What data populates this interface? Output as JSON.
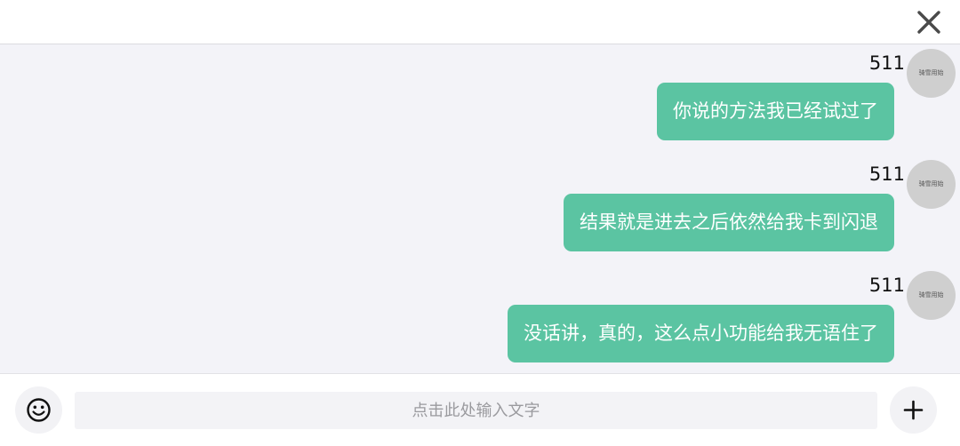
{
  "header": {
    "close_icon": "close-icon"
  },
  "messages": [
    {
      "sender": "511",
      "avatar_text": "骑雪用始",
      "text": "你说的方法我已经试过了"
    },
    {
      "sender": "511",
      "avatar_text": "骑雪用始",
      "text": "结果就是进去之后依然给我卡到闪退"
    },
    {
      "sender": "511",
      "avatar_text": "骑雪用始",
      "text": "没话讲，真的，这么点小功能给我无语住了"
    }
  ],
  "input": {
    "placeholder": "点击此处输入文字",
    "value": "",
    "emoji_icon": "emoji-icon",
    "plus_icon": "plus-icon"
  },
  "colors": {
    "bubble": "#5bc4a2",
    "message_area_bg": "#f3f3f8",
    "avatar_bg": "#cfcfcf"
  }
}
